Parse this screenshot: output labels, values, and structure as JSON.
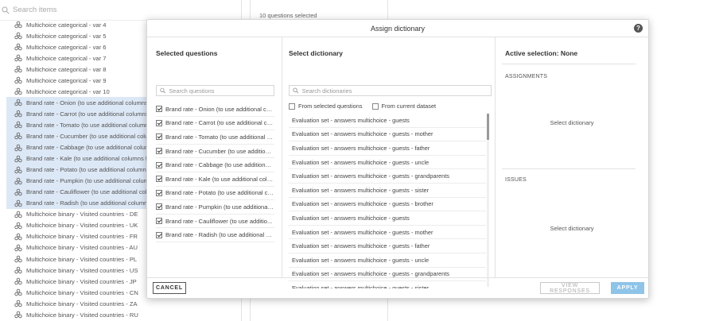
{
  "background": {
    "search_placeholder": "Search items",
    "selected_count": "10 questions selected",
    "items": [
      {
        "label": "Multichoice categorical - var 4",
        "selected": false
      },
      {
        "label": "Multichoice categorical - var 5",
        "selected": false
      },
      {
        "label": "Multichoice categorical - var 6",
        "selected": false
      },
      {
        "label": "Multichoice categorical - var 7",
        "selected": false
      },
      {
        "label": "Multichoice categorical - var 8",
        "selected": false
      },
      {
        "label": "Multichoice categorical - var 9",
        "selected": false
      },
      {
        "label": "Multichoice categorical - var 10",
        "selected": false
      },
      {
        "label": "Brand rate - Onion (to use additional columns",
        "selected": true
      },
      {
        "label": "Brand rate - Carrot (to use additional columns",
        "selected": true
      },
      {
        "label": "Brand rate - Tomato (to use additional columns",
        "selected": true
      },
      {
        "label": "Brand rate - Cucumber (to use additional colum",
        "selected": true
      },
      {
        "label": "Brand rate - Cabbage (to use additional colum",
        "selected": true
      },
      {
        "label": "Brand rate - Kale (to use additional columns fo",
        "selected": true
      },
      {
        "label": "Brand rate - Potato (to use additional columns",
        "selected": true
      },
      {
        "label": "Brand rate - Pumpkin (to use additional column",
        "selected": true
      },
      {
        "label": "Brand rate - Cauliflower (to use additional colu",
        "selected": true
      },
      {
        "label": "Brand rate - Radish (to use additional columns",
        "selected": true
      },
      {
        "label": "Multichoice binary - Visited countries - DE",
        "selected": false
      },
      {
        "label": "Multichoice binary - Visited countries - UK",
        "selected": false
      },
      {
        "label": "Multichoice binary - Visited countries - FR",
        "selected": false
      },
      {
        "label": "Multichoice binary - Visited countries - AU",
        "selected": false
      },
      {
        "label": "Multichoice binary - Visited countries - PL",
        "selected": false
      },
      {
        "label": "Multichoice binary - Visited countries - US",
        "selected": false
      },
      {
        "label": "Multichoice binary - Visited countries - JP",
        "selected": false
      },
      {
        "label": "Multichoice binary - Visited countries - CN",
        "selected": false
      },
      {
        "label": "Multichoice binary - Visited countries - ZA",
        "selected": false
      },
      {
        "label": "Multichoice binary - Visited countries - RU",
        "selected": false
      }
    ]
  },
  "modal": {
    "title": "Assign dictionary",
    "help_icon": "?",
    "selected_questions": {
      "title": "Selected questions",
      "search_placeholder": "Search questions",
      "items": [
        "Brand rate - Onion (to use additional col...",
        "Brand rate - Carrot (to use additional col...",
        "Brand rate - Tomato (to use additional c...",
        "Brand rate - Cucumber (to use additiona...",
        "Brand rate - Cabbage (to use additional ...",
        "Brand rate - Kale (to use additional colu...",
        "Brand rate - Potato (to use additional co...",
        "Brand rate - Pumpkin (to use additional ...",
        "Brand rate - Cauliflower (to use additio...",
        "Brand rate - Radish (to use additional co..."
      ]
    },
    "select_dictionary": {
      "title": "Select dictionary",
      "search_placeholder": "Search dictionaries",
      "filter_selected": "From selected questions",
      "filter_dataset": "From current dataset",
      "items": [
        "Evaluation set - answers multichoice - guests",
        "Evaluation set - answers multichoice - guests - mother",
        "Evaluation set - answers multichoice - guests - father",
        "Evaluation set - answers multichoice - guests - uncle",
        "Evaluation set - answers multichoice - guests - grandparents",
        "Evaluation set - answers multichoice - guests - sister",
        "Evaluation set - answers multichoice - guests - brother",
        "Evaluation set - answers multichoice - guests",
        "Evaluation set - answers multichoice - guests - mother",
        "Evaluation set - answers multichoice - guests - father",
        "Evaluation set - answers multichoice - guests - uncle",
        "Evaluation set - answers multichoice - guests - grandparents",
        "Evaluation set - answers multichoice - guests - sister"
      ]
    },
    "active_selection": {
      "title": "Active selection: None",
      "assignments_label": "ASSIGNMENTS",
      "assignments_msg": "Select dictionary",
      "issues_label": "ISSUES",
      "issues_msg": "Select dictionary"
    },
    "footer": {
      "cancel": "CANCEL",
      "view_responses": "VIEW RESPONSES",
      "apply": "APPLY"
    }
  },
  "colors": {
    "accent": "#8ec4e8",
    "selection": "#dde8f6"
  }
}
